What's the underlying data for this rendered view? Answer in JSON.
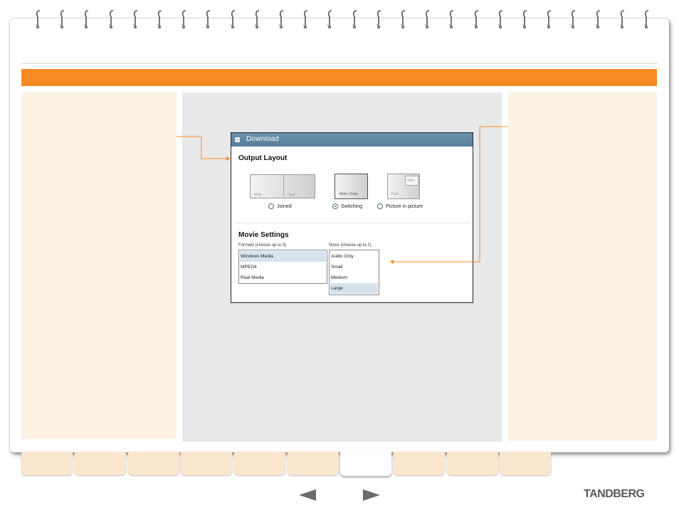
{
  "dialog": {
    "title": "Download",
    "output_layout": {
      "heading": "Output Layout",
      "options": [
        {
          "label": "Joined",
          "selected": false,
          "thumb_labels": [
            "Main",
            "Dual"
          ]
        },
        {
          "label": "Switching",
          "selected": true,
          "thumb_labels": [
            "Main / Dual"
          ]
        },
        {
          "label": "Picture in picture",
          "selected": false,
          "thumb_labels": [
            "Dual",
            "Main"
          ]
        }
      ]
    },
    "movie_settings": {
      "heading": "Movie Settings",
      "formats_caption": "Formats (choose up to 3)",
      "formats": [
        {
          "label": "Windows Media",
          "selected": true
        },
        {
          "label": "MPEG4",
          "selected": false
        },
        {
          "label": "Real Media",
          "selected": false
        }
      ],
      "sizes_caption": "Sizes (choose up to 2)",
      "sizes": [
        {
          "label": "Audio Only",
          "selected": false
        },
        {
          "label": "Small",
          "selected": false
        },
        {
          "label": "Medium",
          "selected": false
        },
        {
          "label": "Large",
          "selected": true
        }
      ]
    }
  },
  "brand": {
    "logo_text": "TANDBERG"
  },
  "colors": {
    "accent": "#f68b24",
    "panel_bg": "#fdf1e4",
    "dialog_header": "#557d99"
  },
  "icons": {
    "prev": "left-arrow-icon",
    "next": "right-arrow-icon",
    "ring": "spiral-ring-icon"
  },
  "tabs": {
    "count": 10,
    "active_index": 6
  }
}
